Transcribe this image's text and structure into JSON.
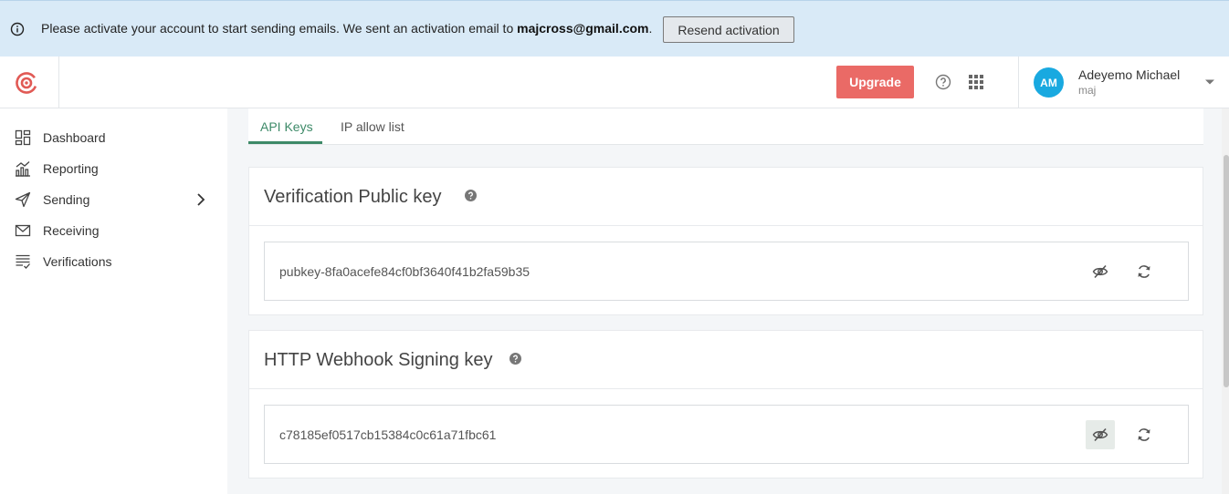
{
  "banner": {
    "message": "Please activate your account to start sending emails. We sent an activation email to ",
    "email": "majcross@gmail.com",
    "period": ".",
    "resend_label": "Resend activation",
    "icon": "info-icon"
  },
  "header": {
    "logo_icon": "at-sign-logo-icon",
    "upgrade_label": "Upgrade",
    "help_icon": "help-icon",
    "apps_icon": "apps-grid-icon",
    "user": {
      "initials": "AM",
      "name": "Adeyemo Michael",
      "sub": "maj",
      "avatar_color": "#19a9e0"
    }
  },
  "sidebar": {
    "items": [
      {
        "label": "Dashboard",
        "icon": "dashboard-icon"
      },
      {
        "label": "Reporting",
        "icon": "reporting-icon"
      },
      {
        "label": "Sending",
        "icon": "sending-icon",
        "has_children": true
      },
      {
        "label": "Receiving",
        "icon": "envelope-icon"
      },
      {
        "label": "Verifications",
        "icon": "verifications-icon"
      }
    ]
  },
  "tabs": [
    {
      "label": "API Keys",
      "active": true
    },
    {
      "label": "IP allow list",
      "active": false
    }
  ],
  "cards": [
    {
      "title": "Verification Public key",
      "key": "pubkey-8fa0acefe84cf0bf3640f41b2fa59b35",
      "actions": [
        "eye-hidden-icon",
        "refresh-icon"
      ]
    },
    {
      "title": "HTTP Webhook Signing key",
      "key": "c78185ef0517cb15384c0c61a71fbc61",
      "actions": [
        "eye-hidden-icon",
        "refresh-icon"
      ]
    }
  ],
  "colors": {
    "banner_bg": "#d9eaf7",
    "upgrade_bg": "#ea6a66",
    "accent": "#3d8a68"
  }
}
